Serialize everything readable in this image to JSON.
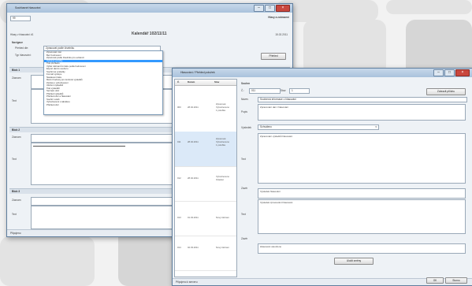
{
  "back_window": {
    "title": "Souhlasné hlasování",
    "top_right_link": "Hlasy a zobrazení",
    "date": "15.02.2011",
    "nav_field": "99",
    "left_header": "Hlasy v hlasování #1",
    "center_title": "Kalendář 102/11/11",
    "section_label": "Navigace",
    "row1_label": "Přehled dle:",
    "row1_value": "Zpracovat podle číselníku",
    "row2_label": "Typ hlasování:",
    "button_label": "Přehled",
    "sections": [
      {
        "title": "Blok 1",
        "fields": [
          {
            "label": "Záznam"
          },
          {
            "label": "Text"
          }
        ]
      },
      {
        "title": "Blok 2",
        "fields": [
          {
            "label": "Záznam"
          },
          {
            "label": "Text"
          }
        ]
      },
      {
        "title": "Blok 3",
        "fields": [
          {
            "label": "Záznam"
          },
          {
            "label": "Text"
          }
        ]
      }
    ],
    "dropdown_items": [
      "Zpracování dat",
      "Bez hodnocení",
      "Zpracovat podle číselníku pro evidenci",
      "Vybrané položky",
      "Tisk přehledu",
      "Výběr záznamů k tisku podle hodnocení",
      "Export dat do souboru",
      "Souhrnné výsledky",
      "Formát výstupu",
      "Nastavení tisku",
      "Mezní hodnoty pro kontrolu výsledků",
      "Zpráva o vyhodnocení",
      "Uložení výsledků",
      "Tisk výsledků",
      "Seznam obcí",
      "Přehled výsledků",
      "Přehled obcí a hlasování",
      "Souhrn voleb",
      "Vyhodnocení s tabulkou",
      "Přehled obcí"
    ],
    "status_text": "Připojeno"
  },
  "front_window": {
    "title": "Hlasování / Přehled položek",
    "list": {
      "headers": [
        "Č.",
        "Datum",
        "Stav"
      ],
      "rows": [
        {
          "num": "000",
          "date": "28.02.2011",
          "status": "Zpracovat",
          "sub": [
            "Vyhodnoceno",
            "1 položka"
          ]
        },
        {
          "num": "011",
          "date": "28.02.2011",
          "status": "Zpracovat",
          "sub": [
            "Vyhodnoceno",
            "1 položka"
          ]
        },
        {
          "num": "012",
          "date": "28.02.2011",
          "status": "Vyhodnoceno",
          "sub": [
            "Odeslat"
          ]
        },
        {
          "num": "013",
          "date": "01.03.2011",
          "status": "Nový záznam",
          "sub": []
        },
        {
          "num": "014",
          "date": "02.03.2011",
          "status": "Nový záznam",
          "sub": []
        }
      ]
    },
    "section_label": "Souhrn",
    "fields": {
      "top_label": "Č.:",
      "top_value": "011",
      "mid_label": "Stav:",
      "mid_value": "1",
      "btn_top": "Zobrazit přílohu",
      "name_label": "Název",
      "name_value": "Souhrnná informace o hlasování",
      "popis_label": "Popis",
      "popis_value": "Zpracování dat z hlasování",
      "stav_label": "Výsledek",
      "stav_value": "Schváleno",
      "text_label": "Text",
      "text_value": "Zpracování výsledků hlasování",
      "rule1_label": "Závěr",
      "rule1_value": "Výsledek hlasování",
      "rule2_label": "Text",
      "rule2_value": "Výsledek zpracování hlasování",
      "rule3_label": "Závěr",
      "rule3_value": "Hlasování ukončeno"
    },
    "bottom_button": "Uložit změny",
    "status_text": "Připojeno k serveru",
    "ok_label": "OK",
    "cancel_label": "Storno"
  }
}
